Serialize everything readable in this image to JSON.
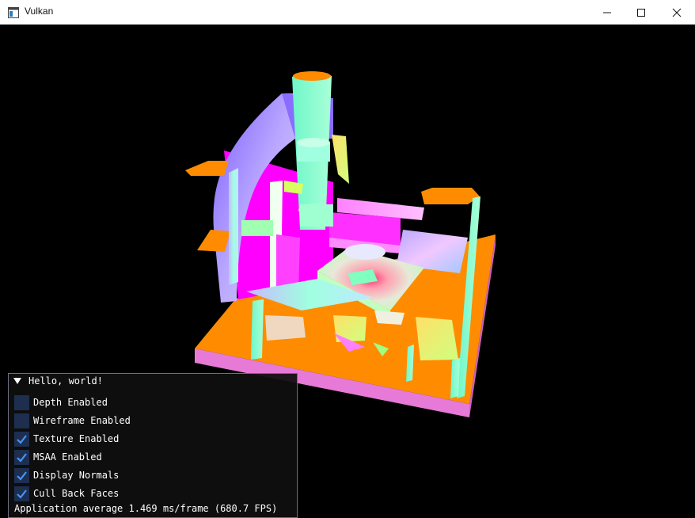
{
  "window": {
    "title": "Vulkan",
    "icon": "app-window-icon",
    "controls": [
      "minimize-icon",
      "maximize-icon",
      "close-icon"
    ]
  },
  "imgui": {
    "title": "Hello, world!",
    "checkboxes": [
      {
        "label": "Depth Enabled",
        "checked": false
      },
      {
        "label": "Wireframe Enabled",
        "checked": false
      },
      {
        "label": "Texture Enabled",
        "checked": true
      },
      {
        "label": "MSAA Enabled",
        "checked": true
      },
      {
        "label": "Display Normals",
        "checked": true
      },
      {
        "label": "Cull Back Faces",
        "checked": true
      }
    ],
    "status": "Application average 1.469 ms/frame (680.7 FPS)"
  },
  "colors": {
    "background": "#000000",
    "floor_orange": "#ff8c00",
    "floor_pink": "#e67ad6",
    "magenta": "#ff00ff",
    "mint": "#7ff7c0",
    "violet": "#8a7cff",
    "checkbox_bg": "#1d2e4f",
    "checkmark": "#4296fa"
  }
}
